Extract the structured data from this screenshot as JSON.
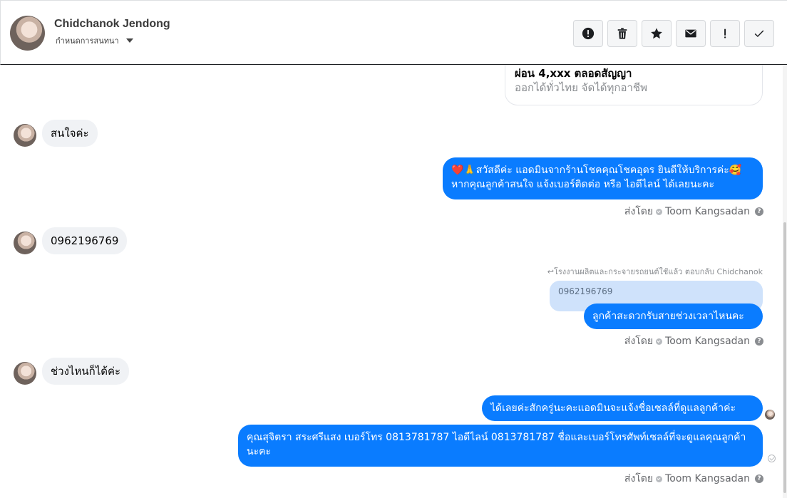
{
  "header": {
    "contact_name": "Chidchanok Jendong",
    "assign_label": "กำหนดการสนทนา",
    "toolbar_icons": [
      "alert-circle-icon",
      "trash-icon",
      "star-icon",
      "envelope-icon",
      "exclamation-icon",
      "check-icon"
    ]
  },
  "messages": {
    "card_title": "ผ่อน 4,xxx ตลอดสัญญา",
    "card_subtitle": "ออกได้ทั่วไทย จัดได้ทุกอาชีพ",
    "in_1": "สนใจค่ะ",
    "out_1_line1": "❤️🙏สวัสดีค่ะ แอดมินจากร้านโชคคุณโชคอุดร ยินดีให้บริการค่ะ🥰",
    "out_1_line2": "หากคุณลูกค้าสนใจ แจ้งเบอร์ติดต่อ หรือ ไอดีไลน์ ได้เลยนะคะ",
    "in_2": "0962196769",
    "reply_note": "↩โรงงานผลิตและกระจายรถยนต์ใช้แล้ว ตอบกลับ Chidchanok",
    "quoted_text": "0962196769",
    "out_2": "ลูกค้าสะดวกรับสายช่วงเวลาไหนคะ",
    "in_3": "ช่วงไหนก็ได้ค่ะ",
    "out_3": "ได้เลยค่ะสักครู่นะคะแอดมินจะแจ้งชื่อเซลล์ที่ดูแลลูกค้าค่ะ",
    "out_4": "คุณสุจิตรา สระศรีแสง      เบอร์โทร 0813781787  ไอดีไลน์ 0813781787 ชื่อและเบอร์โทรศัพท์เซลล์ที่จะดูแลคุณลูกค้านะคะ"
  },
  "sent_by": {
    "prefix": "ส่งโดย",
    "agent": "Toom Kangsadan",
    "help": "?"
  },
  "colors": {
    "outgoing_bubble": "#0a7cff",
    "incoming_bubble": "#f0f2f5",
    "quoted_bubble": "#cfe2fb"
  }
}
